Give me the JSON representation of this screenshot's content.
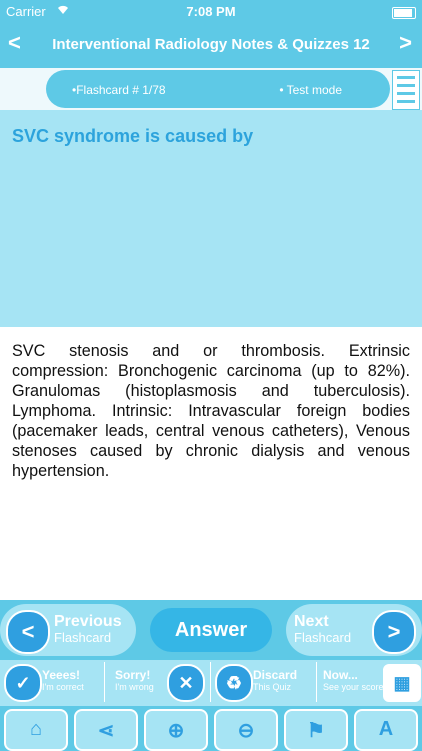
{
  "status": {
    "carrier": "Carrier",
    "time": "7:08 PM"
  },
  "nav": {
    "back": "<",
    "title": "Interventional Radiology Notes & Quizzes 12",
    "forward": ">"
  },
  "mode": {
    "flashcard": "•Flashcard #  1/78",
    "test": "• Test mode"
  },
  "question": {
    "text": "SVC syndrome is caused by"
  },
  "answer": {
    "text": "SVC stenosis and or thrombosis. Extrinsic compression: Bronchogenic carcinoma (up to 82%). Granulomas (histoplasmosis and tuberculosis). Lymphoma. Intrinsic: Intravascular foreign bodies (pacemaker leads, central venous catheters), Venous stenoses caused by chronic dialysis and venous hypertension."
  },
  "actions": {
    "previous": "Previous",
    "previous_sub": "Flashcard",
    "answer": "Answer",
    "next": "Next",
    "next_sub": "Flashcard"
  },
  "grading": {
    "yes": "Yeees!",
    "yes_sub": "I'm correct",
    "sorry": "Sorry!",
    "sorry_sub": "I'm wrong",
    "discard": "Discard",
    "discard_sub": "This Quiz",
    "now": "Now...",
    "now_sub": "See your score"
  },
  "icons": [
    "home-icon",
    "share-icon",
    "zoom-in-icon",
    "zoom-out-icon",
    "bookmark-icon",
    "font-icon"
  ],
  "colors": {
    "primary": "#5ec9e6",
    "light": "#a6e4f4",
    "accent": "#2f9fe0",
    "question_text": "#2ca3dc"
  }
}
